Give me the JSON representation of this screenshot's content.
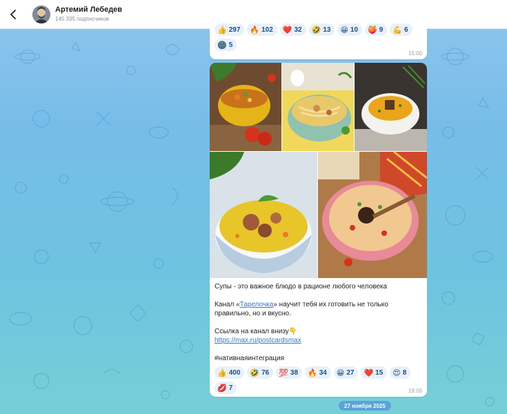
{
  "header": {
    "title": "Артемий Лебедев",
    "subtitle": "145 335 подписчиков"
  },
  "top_message": {
    "reactions": [
      {
        "emoji": "👍",
        "count": "297"
      },
      {
        "emoji": "🔥",
        "count": "102"
      },
      {
        "emoji": "❤️",
        "count": "32"
      },
      {
        "emoji": "🤣",
        "count": "13"
      },
      {
        "emoji": "😁",
        "count": "10"
      },
      {
        "emoji": "🍑",
        "count": "9"
      },
      {
        "emoji": "💪",
        "count": "6"
      },
      {
        "emoji": "🌚",
        "count": "5"
      }
    ],
    "time": "15:00"
  },
  "main_message": {
    "text": {
      "line1": "Супы - это важное блюдо в рационе любого человека",
      "channel_prefix": "Канал «",
      "channel_link": "Тарелочка",
      "channel_suffix": "» научит тебя их готовить не только правильно, но и вкусно.",
      "link_label": "Ссылка на канал внизу👇",
      "url": "https://max.ru/postcardsmax",
      "hashtag": "#нативнаяинтеграция"
    },
    "reactions": [
      {
        "emoji": "👍",
        "count": "400"
      },
      {
        "emoji": "🤣",
        "count": "76"
      },
      {
        "emoji": "💯",
        "count": "38"
      },
      {
        "emoji": "🔥",
        "count": "34"
      },
      {
        "emoji": "😁",
        "count": "27"
      },
      {
        "emoji": "❤️",
        "count": "15"
      },
      {
        "emoji": "😍",
        "count": "8"
      },
      {
        "emoji": "💋",
        "count": "7"
      }
    ],
    "time": "19:00"
  },
  "date_separator": "27 ноября 2025",
  "colors": {
    "link": "#2c7bd6",
    "reaction_bg": "#e8f0f9",
    "reaction_text": "#1e4f86",
    "date_pill": "#5aa3d9"
  }
}
